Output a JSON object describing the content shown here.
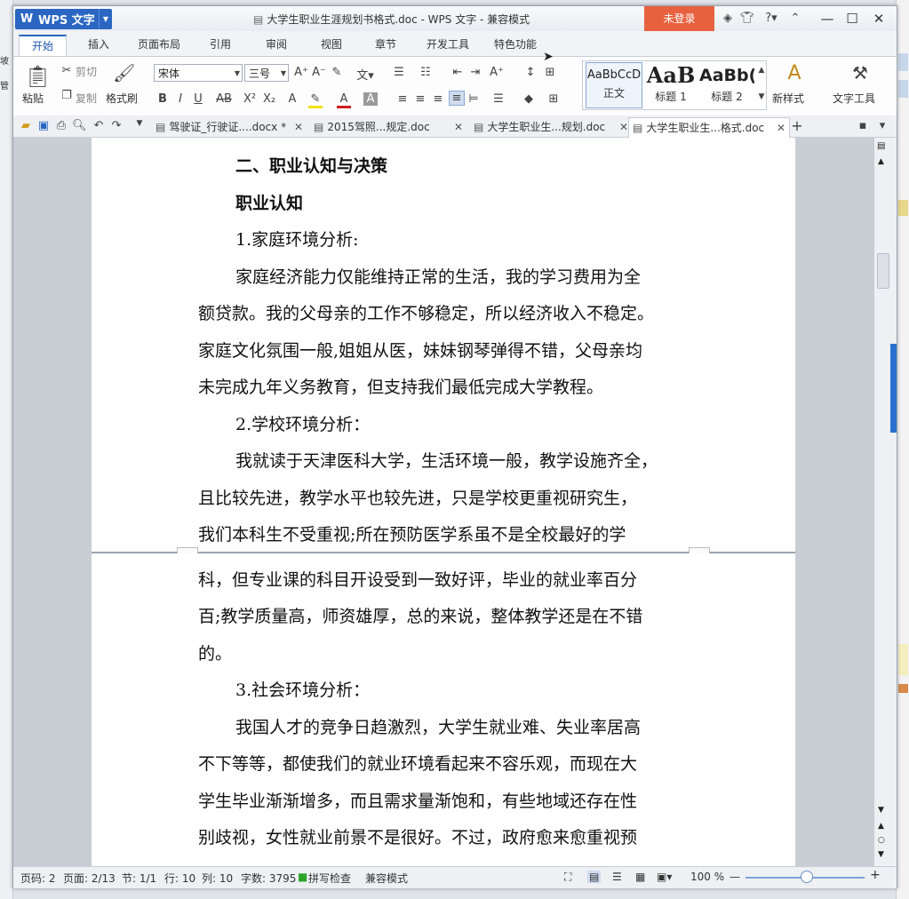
{
  "app": {
    "name": "WPS 文字",
    "title": "大学生职业生涯规划书格式.doc - WPS 文字 - 兼容模式",
    "login": "未登录"
  },
  "tabs": [
    "开始",
    "插入",
    "页面布局",
    "引用",
    "审阅",
    "视图",
    "章节",
    "开发工具",
    "特色功能"
  ],
  "ribbon": {
    "paste": "粘贴",
    "cut": "剪切",
    "copy": "复制",
    "format_painter": "格式刷",
    "font": "宋体",
    "font_size": "三号",
    "styles": [
      {
        "preview": "AaBbCcD",
        "caption": "正文"
      },
      {
        "preview": "AaB",
        "caption": "标题 1"
      },
      {
        "preview": "AaBb(",
        "caption": "标题 2"
      }
    ],
    "new_style": "新样式",
    "text_tools": "文字工具"
  },
  "doc_tabs": [
    {
      "label": "驾驶证_行驶证....docx *",
      "active": false
    },
    {
      "label": "2015驾照...规定.doc",
      "active": false
    },
    {
      "label": "大学生职业生...规划.doc",
      "active": false
    },
    {
      "label": "大学生职业生...格式.doc",
      "active": true
    }
  ],
  "document": {
    "page1": [
      "二、职业认知与决策",
      "职业认知",
      "1.家庭环境分析:",
      "家庭经济能力仅能维持正常的生活，我的学习费用为全",
      "额贷款。我的父母亲的工作不够稳定，所以经济收入不稳定。",
      "家庭文化氛围一般,姐姐从医，妹妹钢琴弹得不错，父母亲均",
      "未完成九年义务教育，但支持我们最低完成大学教程。",
      "2.学校环境分析：",
      "我就读于天津医科大学，生活环境一般，教学设施齐全，",
      "且比较先进，教学水平也较先进，只是学校更重视研究生，",
      "我们本科生不受重视;所在预防医学系虽不是全校最好的学"
    ],
    "page2": [
      "科，但专业课的科目开设受到一致好评，毕业的就业率百分",
      "百;教学质量高，师资雄厚，总的来说，整体教学还是在不错",
      "的。",
      "3.社会环境分析：",
      "我国人才的竞争日趋激烈，大学生就业难、失业率居高",
      "不下等等，都使我们的就业环境看起来不容乐观，而现在大",
      "学生毕业渐渐增多，而且需求量渐饱和，有些地域还存在性",
      "别歧视，女性就业前景不是很好。不过，政府愈来愈重视预"
    ]
  },
  "status": {
    "page_code": "页码: 2",
    "pages": "页面: 2/13",
    "section": "节: 1/1",
    "row": "行: 10",
    "col": "列: 10",
    "words": "字数: 3795",
    "spell": "拼写检查",
    "compat": "兼容模式",
    "zoom": "100 %"
  },
  "colors": {
    "accent": "#2a66c2",
    "login": "#e8613f"
  }
}
